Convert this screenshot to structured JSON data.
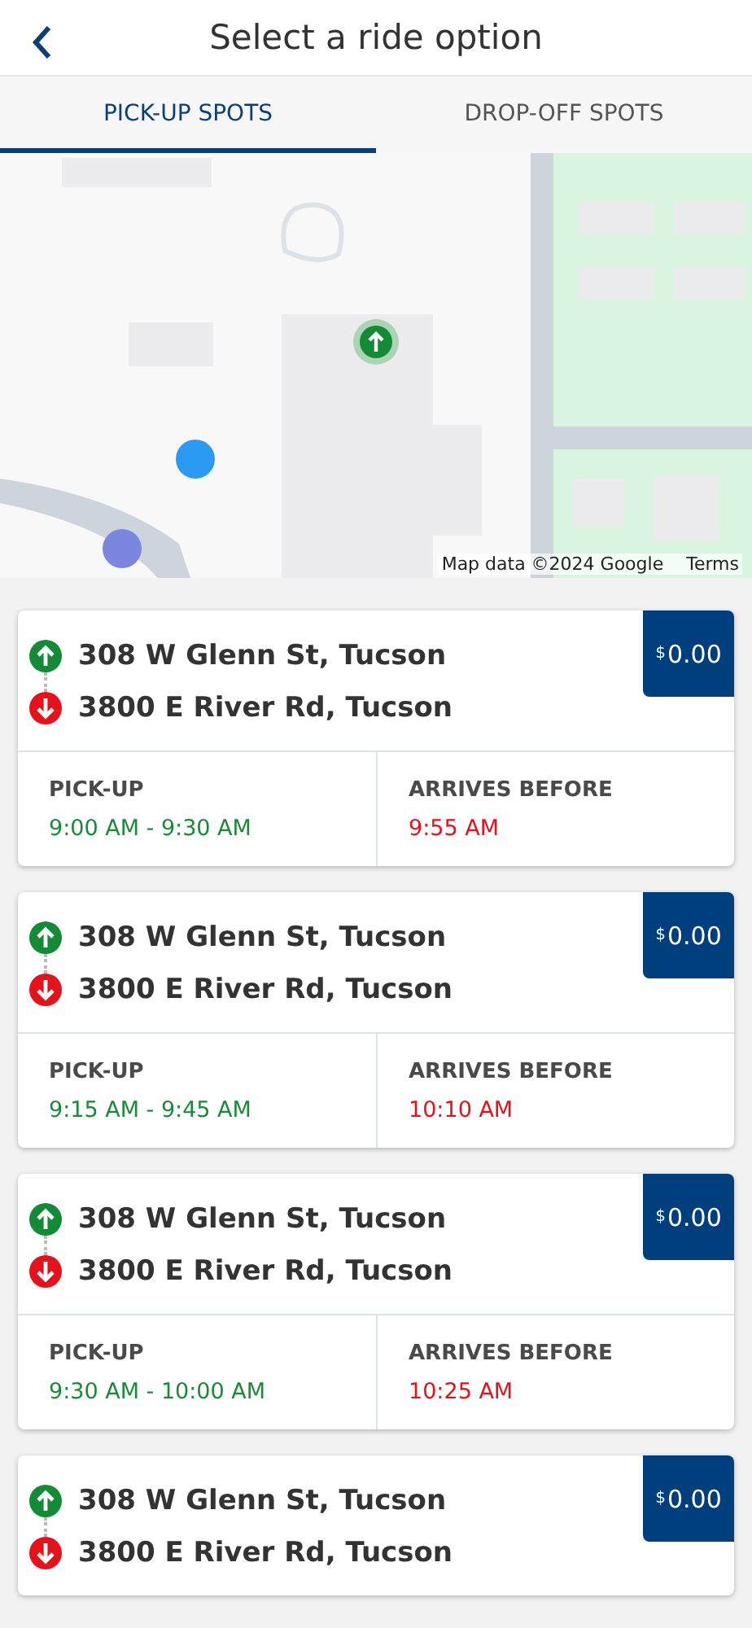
{
  "header": {
    "title": "Select a ride option"
  },
  "tabs": [
    {
      "label": "PICK-UP SPOTS",
      "selected": true
    },
    {
      "label": "DROP-OFF SPOTS",
      "selected": false
    }
  ],
  "map": {
    "kind": "picture",
    "attribution": "Map data ©2024 Google",
    "terms": "Terms"
  },
  "rides": [
    {
      "from": "308 W Glenn St, Tucson",
      "to": "3800 E River Rd, Tucson",
      "currency": "$",
      "amount": "0.00",
      "pickup_label": "PICK-UP",
      "pickup": "9:00 AM - 9:30 AM",
      "arrives_label": "ARRIVES BEFORE",
      "arrives": "9:55 AM"
    },
    {
      "from": "308 W Glenn St, Tucson",
      "to": "3800 E River Rd, Tucson",
      "currency": "$",
      "amount": "0.00",
      "pickup_label": "PICK-UP",
      "pickup": "9:15 AM - 9:45 AM",
      "arrives_label": "ARRIVES BEFORE",
      "arrives": "10:10 AM"
    },
    {
      "from": "308 W Glenn St, Tucson",
      "to": "3800 E River Rd, Tucson",
      "currency": "$",
      "amount": "0.00",
      "pickup_label": "PICK-UP",
      "pickup": "9:30 AM - 10:00 AM",
      "arrives_label": "ARRIVES BEFORE",
      "arrives": "10:25 AM"
    },
    {
      "from": "308 W Glenn St, Tucson",
      "to": "3800 E River Rd, Tucson",
      "currency": "$",
      "amount": "0.00"
    }
  ]
}
